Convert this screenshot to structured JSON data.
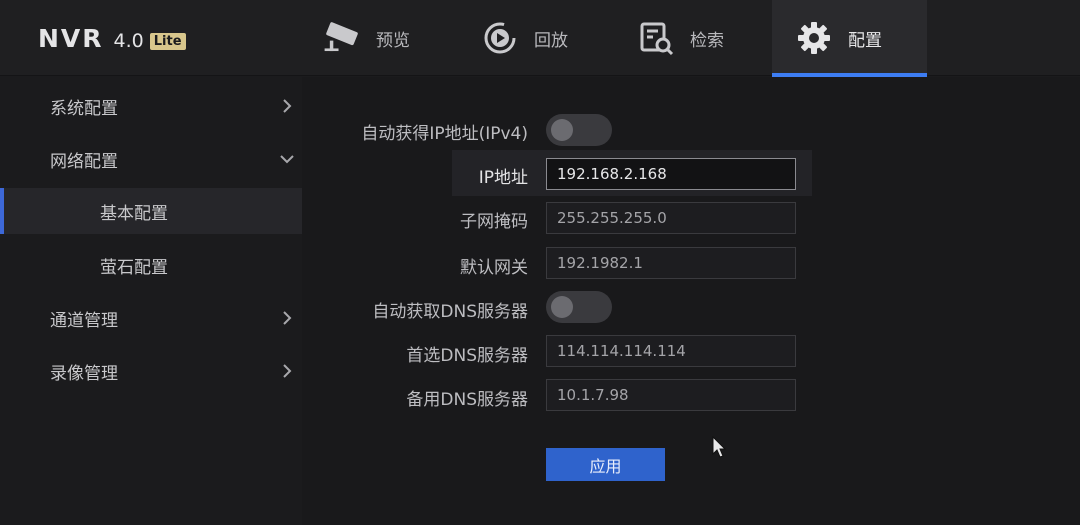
{
  "app": {
    "logo_text": "NVR",
    "version": "4.0",
    "badge": "Lite"
  },
  "nav": {
    "tabs": [
      {
        "label": "预览",
        "icon": "camera-icon"
      },
      {
        "label": "回放",
        "icon": "playback-icon"
      },
      {
        "label": "检索",
        "icon": "search-icon"
      },
      {
        "label": "配置",
        "icon": "gear-icon",
        "active": true
      }
    ]
  },
  "sidebar": {
    "items": [
      {
        "label": "系统配置",
        "expanded": false
      },
      {
        "label": "网络配置",
        "expanded": true
      },
      {
        "label": "基本配置",
        "selected": true
      },
      {
        "label": "萤石配置"
      },
      {
        "label": "通道管理",
        "expanded": false
      },
      {
        "label": "录像管理",
        "expanded": false
      }
    ]
  },
  "form": {
    "auto_ip_label": "自动获得IP地址(IPv4)",
    "auto_ip_enabled": false,
    "ip_label": "IP地址",
    "ip_value": "192.168.2.168",
    "mask_label": "子网掩码",
    "mask_value": "255.255.255.0",
    "gateway_label": "默认网关",
    "gateway_value": "192.1982.1",
    "auto_dns_label": "自动获取DNS服务器",
    "auto_dns_enabled": false,
    "dns1_label": "首选DNS服务器",
    "dns1_value": "114.114.114.114",
    "dns2_label": "备用DNS服务器",
    "dns2_value": "10.1.7.98",
    "apply_label": "应用"
  },
  "colors": {
    "accent": "#3d7df3",
    "button": "#2f63cc",
    "background": "#1b1b1d"
  }
}
